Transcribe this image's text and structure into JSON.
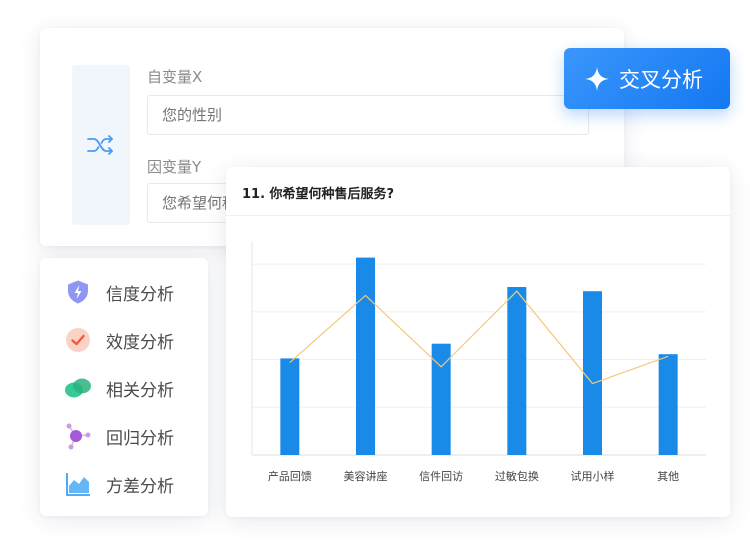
{
  "variables": {
    "x_label": "自变量X",
    "x_placeholder": "您的性别",
    "y_label": "因变量Y",
    "y_placeholder": "您希望何种售后服务？"
  },
  "cross_button": {
    "label": "交叉分析",
    "icon": "sparkle-icon"
  },
  "menu": {
    "items": [
      {
        "label": "信度分析",
        "icon": "shield-icon",
        "color": "#7b87f0"
      },
      {
        "label": "效度分析",
        "icon": "check-circle-icon",
        "color": "#f07b5f"
      },
      {
        "label": "相关分析",
        "icon": "overlap-icon",
        "color": "#2fc38e"
      },
      {
        "label": "回归分析",
        "icon": "nodes-icon",
        "color": "#a25bd6"
      },
      {
        "label": "方差分析",
        "icon": "area-chart-icon",
        "color": "#3aa0f0"
      }
    ]
  },
  "chart": {
    "question_title": "11. 你希望何种售后服务?"
  },
  "chart_data": {
    "type": "bar",
    "title": "11. 你希望何种售后服务?",
    "categories": [
      "产品回馈",
      "美容讲座",
      "信件回访",
      "过敏包换",
      "试用小样",
      "其他"
    ],
    "series": [
      {
        "type": "bar",
        "values": [
          0.46,
          0.94,
          0.53,
          0.8,
          0.78,
          0.48
        ],
        "color": "#1a8ae8"
      },
      {
        "type": "line",
        "values": [
          0.44,
          0.76,
          0.42,
          0.78,
          0.34,
          0.47
        ],
        "color": "#f5c87a"
      }
    ],
    "ylim": [
      0,
      1
    ],
    "grid": true,
    "xlabel": "",
    "ylabel": ""
  }
}
